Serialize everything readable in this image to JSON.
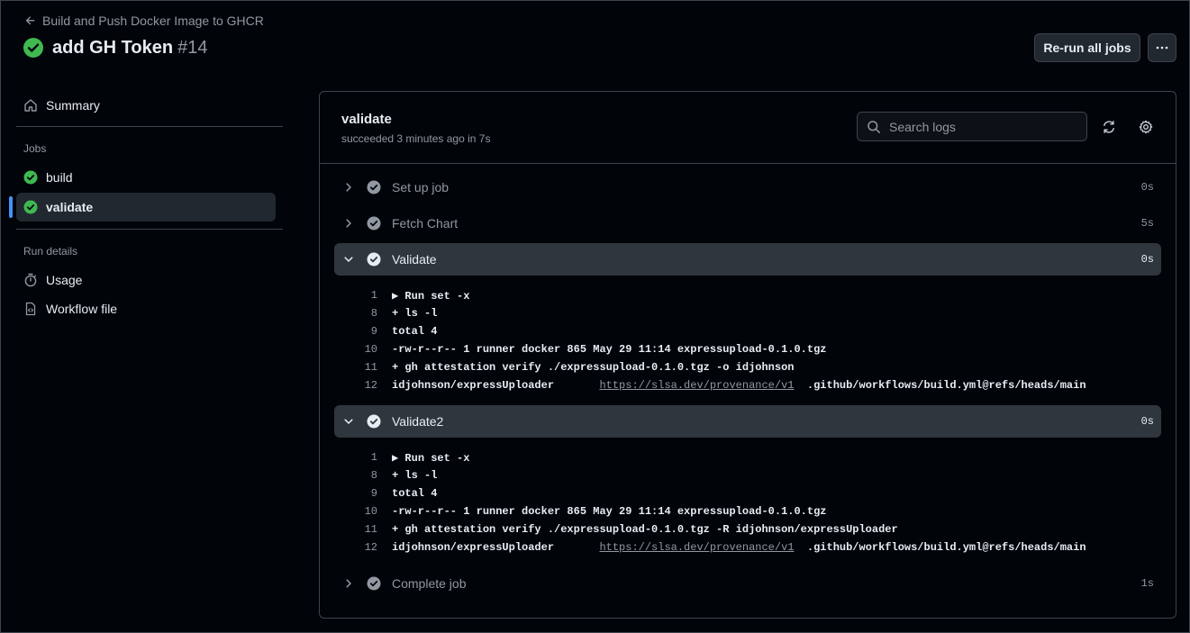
{
  "header": {
    "back_label": "Build and Push Docker Image to GHCR",
    "run_title": "add GH Token",
    "run_number": "#14",
    "rerun_label": "Re-run all jobs",
    "more_label": "···"
  },
  "sidebar": {
    "summary_label": "Summary",
    "jobs_heading": "Jobs",
    "jobs": [
      {
        "label": "build",
        "selected": false
      },
      {
        "label": "validate",
        "selected": true
      }
    ],
    "run_details_heading": "Run details",
    "usage_label": "Usage",
    "workflow_file_label": "Workflow file"
  },
  "job": {
    "name": "validate",
    "status": "succeeded 3 minutes ago in 7s",
    "search_placeholder": "Search logs"
  },
  "steps": [
    {
      "name": "Set up job",
      "duration": "0s",
      "expanded": false
    },
    {
      "name": "Fetch Chart",
      "duration": "5s",
      "expanded": false
    },
    {
      "name": "Validate",
      "duration": "0s",
      "expanded": true,
      "lines": [
        {
          "num": "1",
          "text": "▶ Run set -x"
        },
        {
          "num": "8",
          "text": "+ ls -l"
        },
        {
          "num": "9",
          "text": "total 4"
        },
        {
          "num": "10",
          "text": "-rw-r--r-- 1 runner docker 865 May 29 11:14 expressupload-0.1.0.tgz"
        },
        {
          "num": "11",
          "text": "+ gh attestation verify ./expressupload-0.1.0.tgz -o idjohnson"
        },
        {
          "num": "12",
          "text": "idjohnson/expressUploader       ",
          "url": "https://slsa.dev/provenance/v1",
          "tail": "  .github/workflows/build.yml@refs/heads/main"
        }
      ]
    },
    {
      "name": "Validate2",
      "duration": "0s",
      "expanded": true,
      "lines": [
        {
          "num": "1",
          "text": "▶ Run set -x"
        },
        {
          "num": "8",
          "text": "+ ls -l"
        },
        {
          "num": "9",
          "text": "total 4"
        },
        {
          "num": "10",
          "text": "-rw-r--r-- 1 runner docker 865 May 29 11:14 expressupload-0.1.0.tgz"
        },
        {
          "num": "11",
          "text": "+ gh attestation verify ./expressupload-0.1.0.tgz -R idjohnson/expressUploader"
        },
        {
          "num": "12",
          "text": "idjohnson/expressUploader       ",
          "url": "https://slsa.dev/provenance/v1",
          "tail": "  .github/workflows/build.yml@refs/heads/main"
        }
      ]
    },
    {
      "name": "Complete job",
      "duration": "1s",
      "expanded": false
    }
  ],
  "colors": {
    "success_green": "#3fb950",
    "accent_blue": "#4493f8",
    "step_check_gray": "#9198a1",
    "background": "#010409"
  }
}
